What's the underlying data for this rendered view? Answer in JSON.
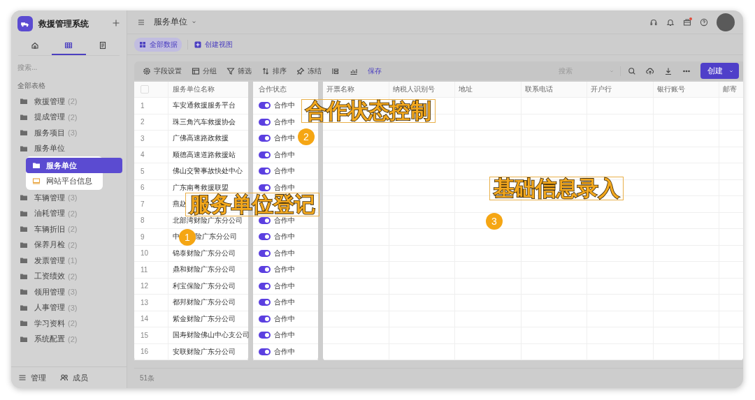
{
  "sidebar": {
    "title": "救援管理系统",
    "nav_tabs": [
      {
        "kind": "home",
        "selected": false
      },
      {
        "kind": "table",
        "selected": true
      },
      {
        "kind": "doc",
        "selected": false
      }
    ],
    "search": {
      "placeholder": "搜索..."
    },
    "section": "全部表格",
    "groups": [
      {
        "label": "救援管理",
        "count": "(2)"
      },
      {
        "label": "提成管理",
        "count": "(2)"
      },
      {
        "label": "服务项目",
        "count": "(3)"
      },
      {
        "label": "服务单位",
        "children": [
          {
            "label": "服务单位",
            "kind": "table",
            "selected": true
          },
          {
            "label": "网站平台信息",
            "kind": "screen",
            "selected": false
          }
        ]
      },
      {
        "label": "车辆管理",
        "count": "(3)"
      },
      {
        "label": "油耗管理",
        "count": "(2)"
      },
      {
        "label": "车辆折旧",
        "count": "(2)"
      },
      {
        "label": "保养月检",
        "count": "(2)"
      },
      {
        "label": "发票管理",
        "count": "(1)"
      },
      {
        "label": "工资绩效",
        "count": "(2)"
      },
      {
        "label": "领用管理",
        "count": "(3)"
      },
      {
        "label": "人事管理",
        "count": "(3)"
      },
      {
        "label": "学习资料",
        "count": "(2)"
      },
      {
        "label": "系统配置",
        "count": "(2)"
      }
    ],
    "footer": [
      {
        "label": "管理",
        "kind": "sliders"
      },
      {
        "label": "成员",
        "kind": "people"
      }
    ]
  },
  "header": {
    "title": "服务单位",
    "notification_dot": true
  },
  "views": [
    {
      "label": "全部数据",
      "selected": true
    }
  ],
  "create_view": "创建视图",
  "toolbar": {
    "items": [
      {
        "label": "字段设置",
        "kind": "gear"
      },
      {
        "label": "分组",
        "kind": "group"
      },
      {
        "label": "筛选",
        "kind": "filter"
      },
      {
        "label": "排序",
        "kind": "sort"
      },
      {
        "label": "冻结",
        "kind": "pin"
      }
    ],
    "save": "保存",
    "search": {
      "placeholder": "搜索"
    },
    "create": "创建"
  },
  "table": {
    "select_all": false,
    "name_column": "服务单位名称",
    "status_column": "合作状态",
    "other_columns": [
      "开票名称",
      "纳税人识别号",
      "地址",
      "联系电话",
      "开户行",
      "银行账号",
      "邮寄"
    ],
    "rows": [
      {
        "no": "1",
        "name": "车安通救援服务平台",
        "on": true,
        "status": "合作中"
      },
      {
        "no": "2",
        "name": "珠三角汽车救援协会",
        "on": true,
        "status": "合作中"
      },
      {
        "no": "3",
        "name": "广佛高速路政救援",
        "on": true,
        "status": "合作中"
      },
      {
        "no": "4",
        "name": "顺德高速道路救援站",
        "on": true,
        "status": "合作中"
      },
      {
        "no": "5",
        "name": "佛山交警事故快处中心",
        "on": true,
        "status": "合作中"
      },
      {
        "no": "6",
        "name": "广东南粤救援联盟",
        "on": true,
        "status": "合作中"
      },
      {
        "no": "7",
        "name": "燕赵"
      },
      {
        "no": "8",
        "name": "北部湾财险广东分公司",
        "on": true,
        "status": "合作中"
      },
      {
        "no": "9",
        "name": "中",
        "name_tail": "险广东分公司",
        "on": true,
        "status": "合作中"
      },
      {
        "no": "10",
        "name": "锦泰财险广东分公司",
        "on": true,
        "status": "合作中"
      },
      {
        "no": "11",
        "name": "鼎和财险广东分公司",
        "on": true,
        "status": "合作中"
      },
      {
        "no": "12",
        "name": "利宝保险广东分公司",
        "on": true,
        "status": "合作中"
      },
      {
        "no": "13",
        "name": "都邦财险广东分公司",
        "on": true,
        "status": "合作中"
      },
      {
        "no": "14",
        "name": "紫金财险广东分公司",
        "on": true,
        "status": "合作中"
      },
      {
        "no": "15",
        "name": "国寿财险佛山中心支公司",
        "on": true,
        "status": "合作中"
      },
      {
        "no": "16",
        "name": "安联财险广东分公司",
        "on": true,
        "status": "合作中"
      }
    ],
    "total": "51条"
  },
  "callouts": [
    {
      "label": "合作状态控制",
      "number": "2"
    },
    {
      "label": "服务单位登记",
      "number": "1"
    },
    {
      "label": "基础信息录入",
      "number": "3"
    }
  ]
}
